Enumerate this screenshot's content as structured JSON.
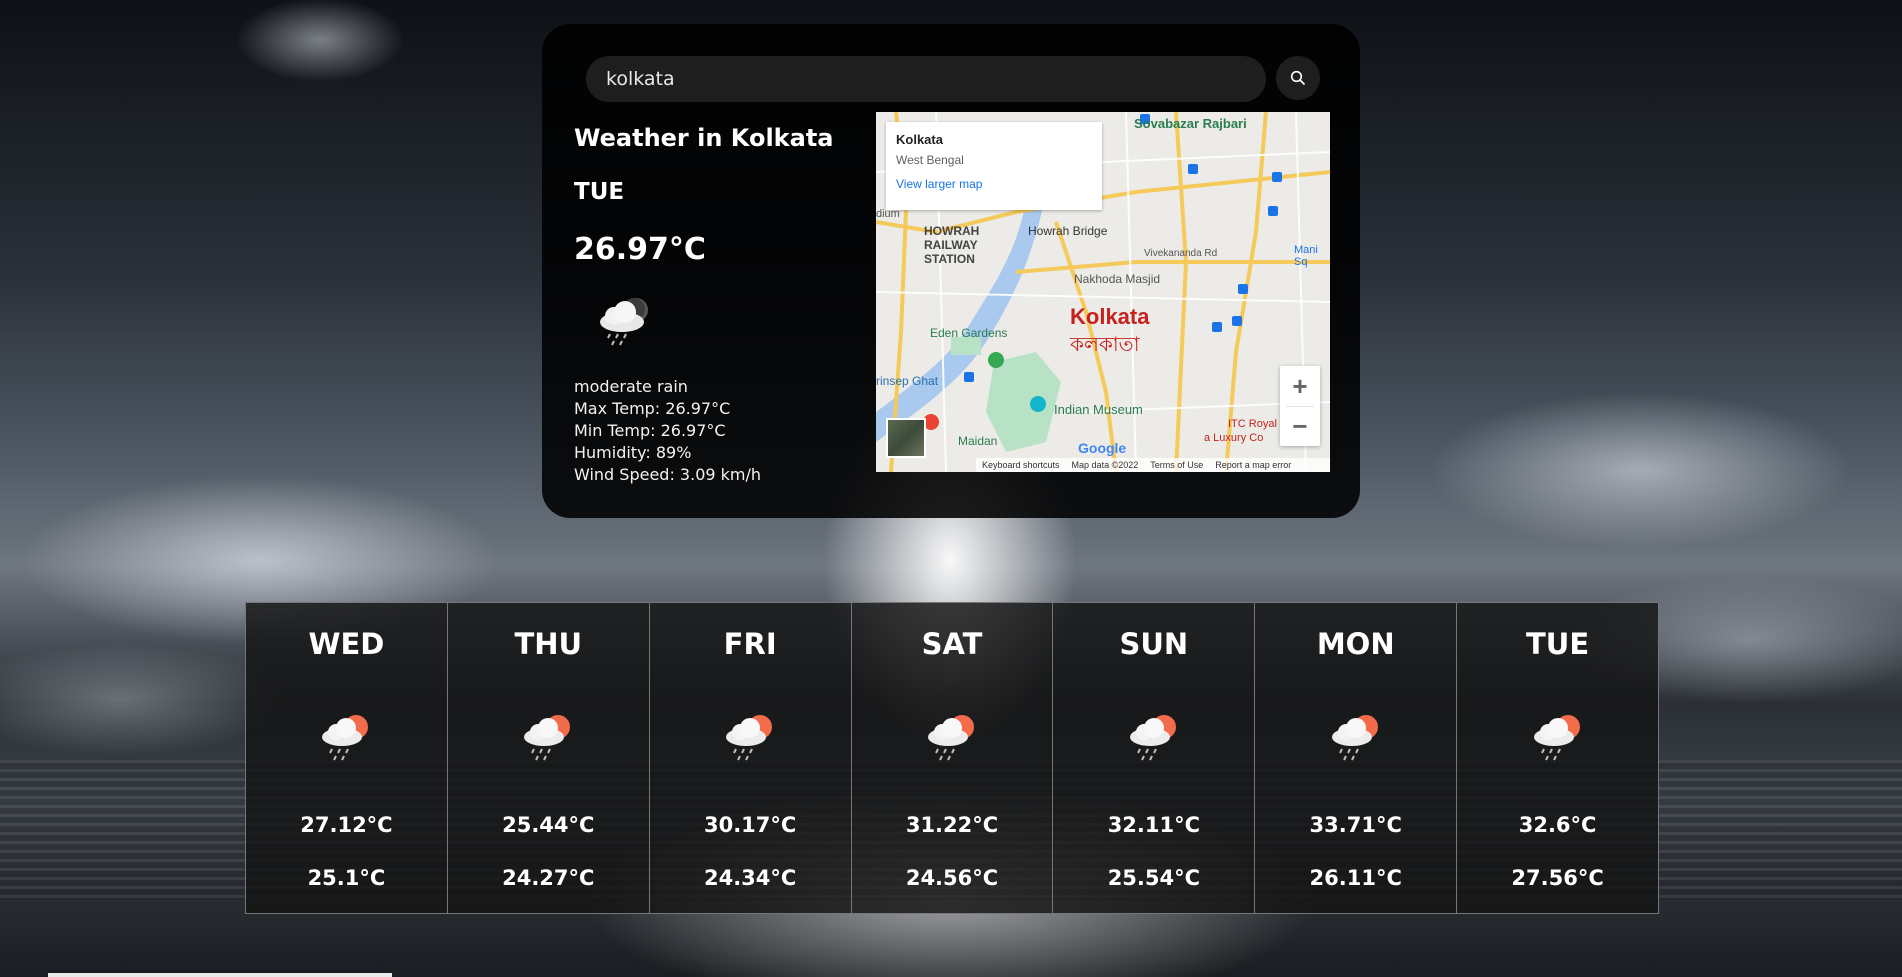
{
  "search": {
    "value": "kolkata",
    "button_icon": "search-icon"
  },
  "current": {
    "title": "Weather in Kolkata",
    "day": "TUE",
    "temp": "26.97°C",
    "icon": "rain-cloud-night-icon",
    "description": "moderate rain",
    "max_temp": "Max Temp: 26.97°C",
    "min_temp": "Min Temp: 26.97°C",
    "humidity": "Humidity: 89%",
    "wind_speed": "Wind Speed: 3.09 km/h"
  },
  "map": {
    "info_name": "Kolkata",
    "info_region": "West Bengal",
    "info_link": "View larger map",
    "city_label": "Kolkata",
    "city_label_local": "কলকাতা",
    "places": {
      "sovabazar": "Sovabazar Rajbari",
      "howrah_bridge": "Howrah Bridge",
      "howrah_station": "HOWRAH RAILWAY STATION",
      "nakhoda": "Nakhoda Masjid",
      "vivekananda": "Vivekananda Rd",
      "eden": "Eden Gardens",
      "prinsep": "rinsep Ghat",
      "indian_museum": "Indian Museum",
      "maidan": "Maidan",
      "itc": "ITC Royal",
      "luxury": "a Luxury Co",
      "mani": "Mani Sq",
      "dium": "dium"
    },
    "google": "Google",
    "footer": {
      "shortcuts": "Keyboard shortcuts",
      "map_data": "Map data ©2022",
      "terms": "Terms of Use",
      "report": "Report a map error"
    },
    "zoom_in": "+",
    "zoom_out": "−",
    "colors": {
      "water": "#a9c9ef",
      "park": "#b7e2c5",
      "road": "#f6c95b",
      "label_red": "#c5221f"
    }
  },
  "forecast": [
    {
      "day": "WED",
      "max": "27.12°C",
      "min": "25.1°C",
      "icon": "rain-cloud-sun-icon"
    },
    {
      "day": "THU",
      "max": "25.44°C",
      "min": "24.27°C",
      "icon": "rain-cloud-sun-icon"
    },
    {
      "day": "FRI",
      "max": "30.17°C",
      "min": "24.34°C",
      "icon": "rain-cloud-sun-icon"
    },
    {
      "day": "SAT",
      "max": "31.22°C",
      "min": "24.56°C",
      "icon": "rain-cloud-sun-icon"
    },
    {
      "day": "SUN",
      "max": "32.11°C",
      "min": "25.54°C",
      "icon": "rain-cloud-sun-icon"
    },
    {
      "day": "MON",
      "max": "33.71°C",
      "min": "26.11°C",
      "icon": "rain-cloud-sun-icon"
    },
    {
      "day": "TUE",
      "max": "32.6°C",
      "min": "27.56°C",
      "icon": "rain-cloud-sun-icon"
    }
  ]
}
